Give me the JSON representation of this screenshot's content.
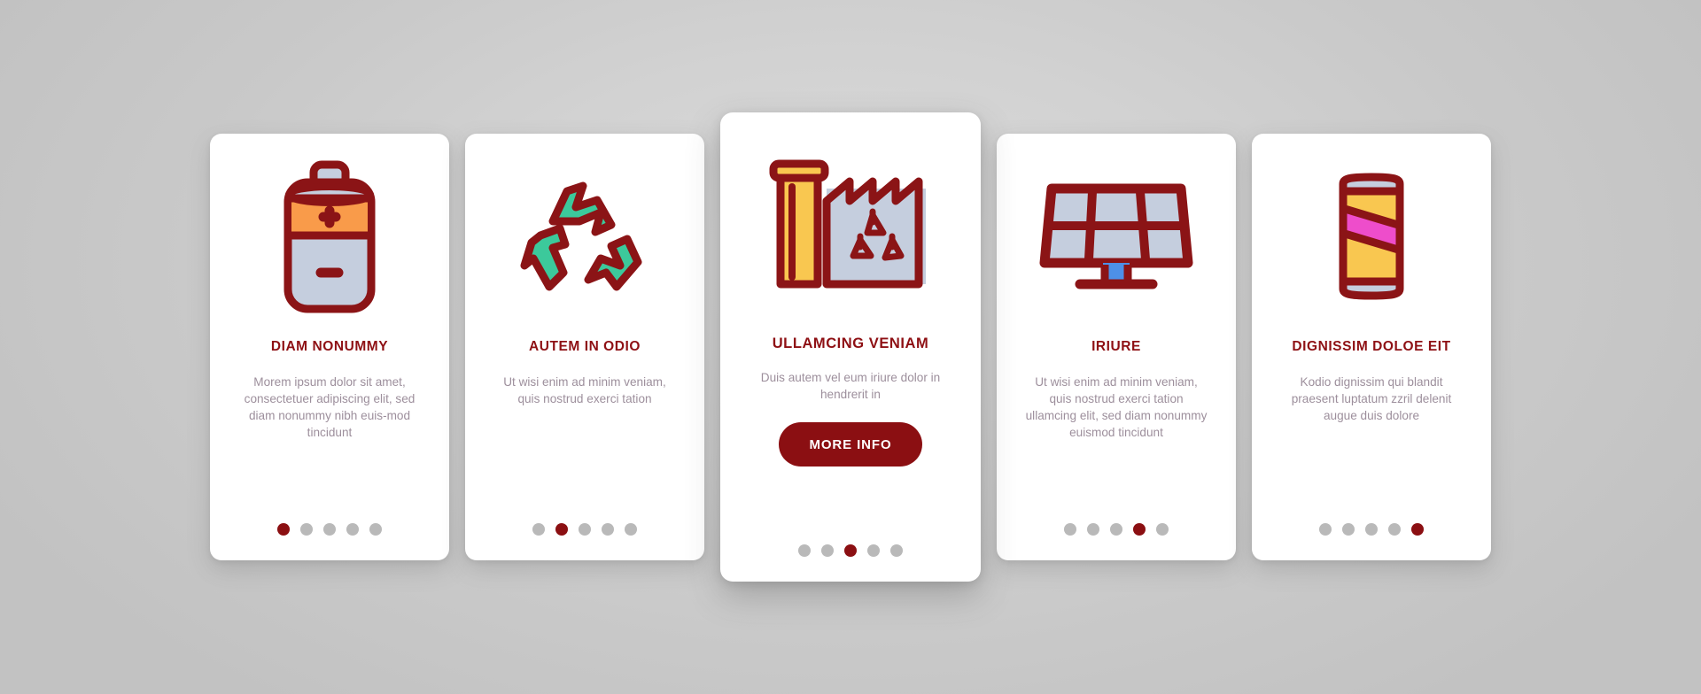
{
  "theme": {
    "accent": "#8B0F12",
    "body_text": "#9D8F9C",
    "dot_inactive": "#B9B9B9",
    "card_bg": "#FFFFFF",
    "page_bg": "#CFCFCF",
    "icon_outline": "#8B1416",
    "icon_gray_blue": "#C5CEDE",
    "icon_orange": "#F99B4A",
    "icon_yellow": "#F9C750",
    "icon_teal": "#3CC99B",
    "icon_magenta": "#EE4DCB",
    "icon_blue": "#4D90E8"
  },
  "cards": [
    {
      "id": "card-battery",
      "icon": "battery-icon",
      "title": "DIAM NONUMMY",
      "body": "Morem ipsum dolor sit amet, consectetuer adipiscing elit, sed diam nonummy nibh euis-mod tincidunt",
      "featured": false,
      "cta": null,
      "dots": {
        "count": 5,
        "active_index": 0
      }
    },
    {
      "id": "card-recycle",
      "icon": "recycle-icon",
      "title": "AUTEM IN ODIO",
      "body": "Ut wisi enim ad minim veniam, quis nostrud exerci tation",
      "featured": false,
      "cta": null,
      "dots": {
        "count": 5,
        "active_index": 1
      }
    },
    {
      "id": "card-factory",
      "icon": "factory-recycling-icon",
      "title": "ULLAMCING VENIAM",
      "body": "Duis autem vel eum iriure dolor in hendrerit in",
      "featured": true,
      "cta": "MORE INFO",
      "dots": {
        "count": 5,
        "active_index": 2
      }
    },
    {
      "id": "card-solar",
      "icon": "solar-panel-icon",
      "title": "IRIURE",
      "body": "Ut wisi enim ad minim veniam, quis nostrud exerci tation ullamcing elit, sed diam nonummy euismod tincidunt",
      "featured": false,
      "cta": null,
      "dots": {
        "count": 5,
        "active_index": 3
      }
    },
    {
      "id": "card-can",
      "icon": "aluminum-can-icon",
      "title": "DIGNISSIM DOLOE EIT",
      "body": "Kodio dignissim qui blandit praesent luptatum zzril delenit augue duis dolore",
      "featured": false,
      "cta": null,
      "dots": {
        "count": 5,
        "active_index": 4
      }
    }
  ]
}
